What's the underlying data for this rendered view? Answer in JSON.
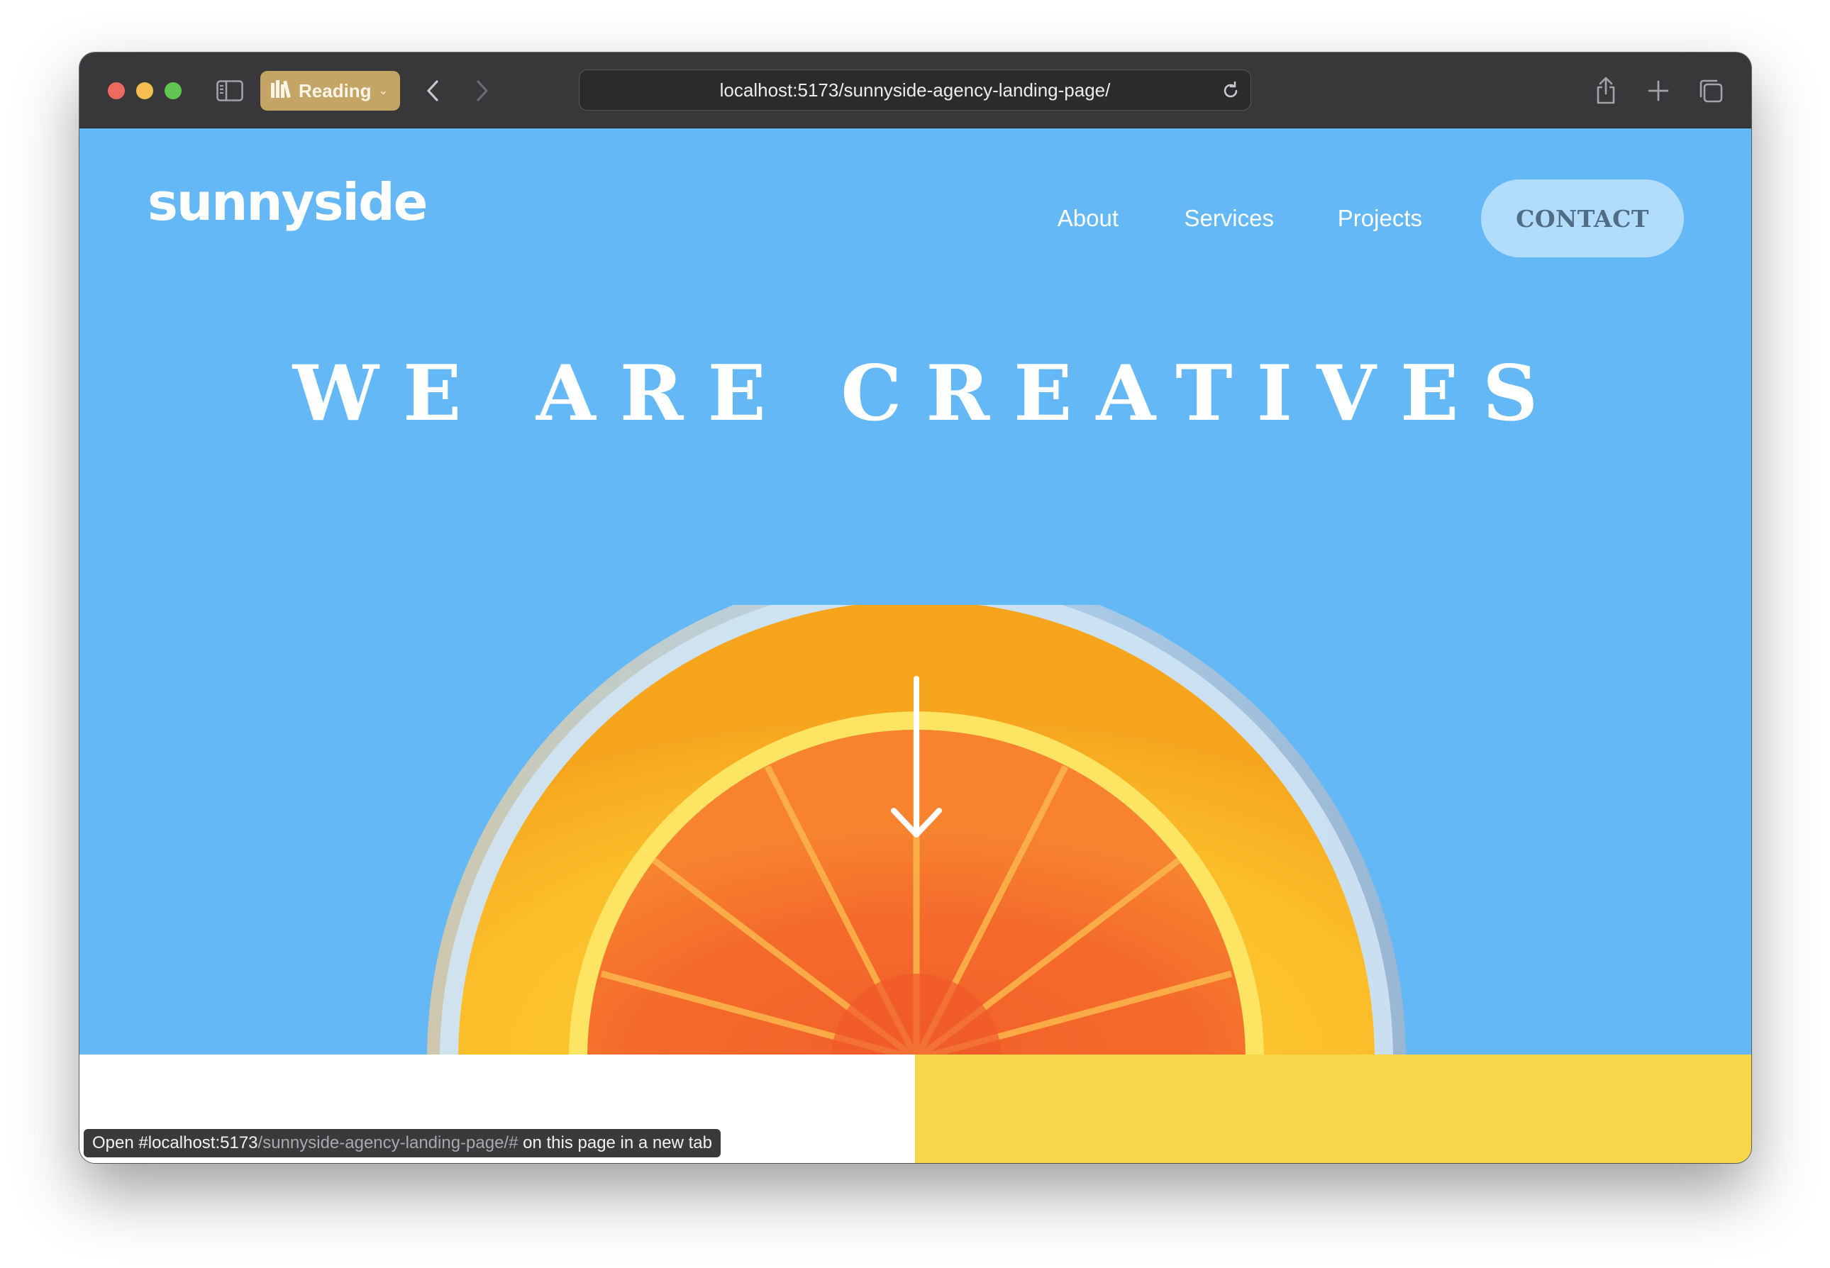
{
  "browser": {
    "reading_label": "Reading",
    "url": "localhost:5173/sunnyside-agency-landing-page/",
    "icons": {
      "sidebar": "sidebar-icon",
      "reading": "reading-list-icon",
      "back": "chevron-left-icon",
      "forward": "chevron-right-icon",
      "reload": "reload-icon",
      "share": "share-icon",
      "new_tab": "plus-icon",
      "tabs": "tab-overview-icon"
    }
  },
  "site": {
    "logo": "sunnyside",
    "nav": {
      "about": "About",
      "services": "Services",
      "projects": "Projects",
      "contact": "CONTACT"
    },
    "hero_title": "WE ARE CREATIVES",
    "scroll_icon": "arrow-down-icon"
  },
  "status_bar": {
    "prefix": "Open ",
    "host": "#localhost:5173",
    "path": "/sunnyside-agency-landing-page/#",
    "suffix": " on this page in a new tab"
  },
  "colors": {
    "hero_bg": "#64b8f5",
    "contact_bg": "#b2dcfb",
    "accent_yellow": "#f7d64a",
    "toolbar": "#38383b",
    "reading_pill": "#c4a565"
  }
}
